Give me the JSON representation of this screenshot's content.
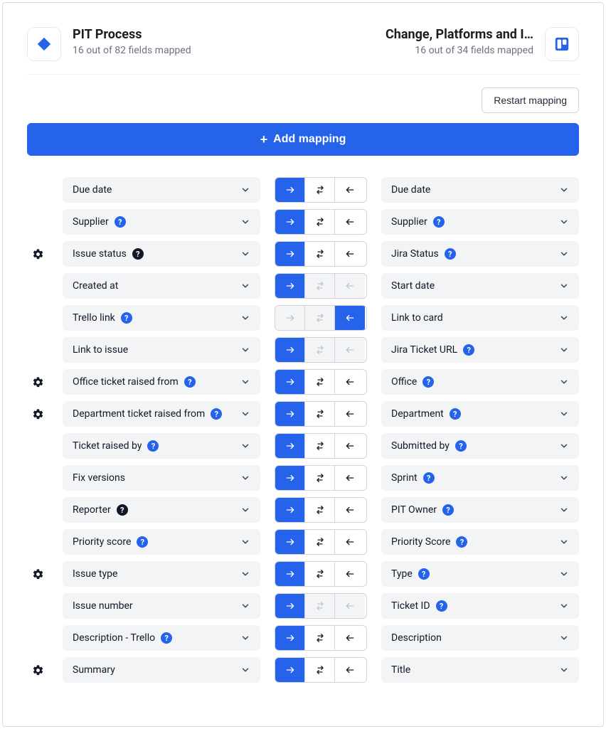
{
  "left": {
    "title": "PIT Process",
    "subtitle": "16 out of 82 fields mapped",
    "icon": "jira"
  },
  "right": {
    "title": "Change, Platforms and I…",
    "subtitle": "16 out of 34 fields mapped",
    "icon": "trello"
  },
  "buttons": {
    "restart": "Restart mapping",
    "add": "Add mapping"
  },
  "mappings": [
    {
      "gear": false,
      "left": {
        "label": "Due date"
      },
      "right": {
        "label": "Due date"
      },
      "dir": {
        "mode": "right",
        "bothEnabled": true,
        "leftEnabled": true
      }
    },
    {
      "gear": false,
      "left": {
        "label": "Supplier",
        "info": "blue"
      },
      "right": {
        "label": "Supplier",
        "info": "blue"
      },
      "dir": {
        "mode": "right",
        "bothEnabled": true,
        "leftEnabled": true
      }
    },
    {
      "gear": true,
      "left": {
        "label": "Issue status",
        "info": "black"
      },
      "right": {
        "label": "Jira Status",
        "info": "blue"
      },
      "dir": {
        "mode": "right",
        "bothEnabled": true,
        "leftEnabled": true
      }
    },
    {
      "gear": false,
      "left": {
        "label": "Created at"
      },
      "right": {
        "label": "Start date"
      },
      "dir": {
        "mode": "right",
        "bothEnabled": false,
        "leftEnabled": false
      }
    },
    {
      "gear": false,
      "left": {
        "label": "Trello link",
        "info": "blue"
      },
      "right": {
        "label": "Link to card"
      },
      "dir": {
        "mode": "left",
        "rightEnabled": false,
        "bothEnabled": false
      }
    },
    {
      "gear": false,
      "left": {
        "label": "Link to issue"
      },
      "right": {
        "label": "Jira Ticket URL",
        "info": "blue"
      },
      "dir": {
        "mode": "right",
        "bothEnabled": false,
        "leftEnabled": false
      }
    },
    {
      "gear": true,
      "left": {
        "label": "Office ticket raised from",
        "info": "blue"
      },
      "right": {
        "label": "Office",
        "info": "blue"
      },
      "dir": {
        "mode": "right",
        "bothEnabled": true,
        "leftEnabled": true
      }
    },
    {
      "gear": true,
      "left": {
        "label": "Department ticket raised from",
        "info": "blue"
      },
      "right": {
        "label": "Department",
        "info": "blue"
      },
      "dir": {
        "mode": "right",
        "bothEnabled": true,
        "leftEnabled": true
      }
    },
    {
      "gear": false,
      "left": {
        "label": "Ticket raised by",
        "info": "blue"
      },
      "right": {
        "label": "Submitted by",
        "info": "blue"
      },
      "dir": {
        "mode": "right",
        "bothEnabled": true,
        "leftEnabled": true
      }
    },
    {
      "gear": false,
      "left": {
        "label": "Fix versions"
      },
      "right": {
        "label": "Sprint",
        "info": "blue"
      },
      "dir": {
        "mode": "right",
        "bothEnabled": true,
        "leftEnabled": true
      }
    },
    {
      "gear": false,
      "left": {
        "label": "Reporter",
        "info": "black"
      },
      "right": {
        "label": "PIT Owner",
        "info": "blue"
      },
      "dir": {
        "mode": "right",
        "bothEnabled": true,
        "leftEnabled": true
      }
    },
    {
      "gear": false,
      "left": {
        "label": "Priority score",
        "info": "blue"
      },
      "right": {
        "label": "Priority Score",
        "info": "blue"
      },
      "dir": {
        "mode": "right",
        "bothEnabled": true,
        "leftEnabled": true
      }
    },
    {
      "gear": true,
      "left": {
        "label": "Issue type"
      },
      "right": {
        "label": "Type",
        "info": "blue"
      },
      "dir": {
        "mode": "right",
        "bothEnabled": true,
        "leftEnabled": true
      }
    },
    {
      "gear": false,
      "left": {
        "label": "Issue number"
      },
      "right": {
        "label": "Ticket ID",
        "info": "blue"
      },
      "dir": {
        "mode": "right",
        "bothEnabled": false,
        "leftEnabled": false
      }
    },
    {
      "gear": false,
      "left": {
        "label": "Description - Trello",
        "info": "blue"
      },
      "right": {
        "label": "Description"
      },
      "dir": {
        "mode": "right",
        "bothEnabled": true,
        "leftEnabled": true
      }
    },
    {
      "gear": true,
      "left": {
        "label": "Summary"
      },
      "right": {
        "label": "Title"
      },
      "dir": {
        "mode": "right",
        "bothEnabled": true,
        "leftEnabled": true
      }
    }
  ]
}
